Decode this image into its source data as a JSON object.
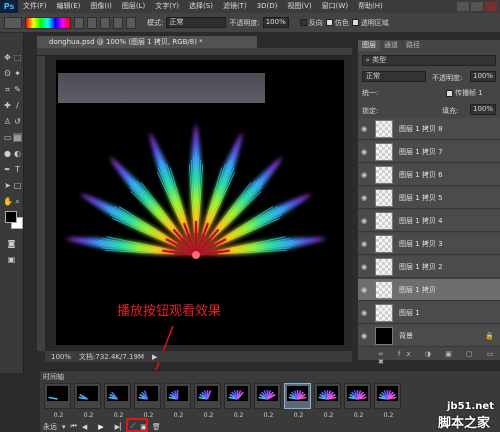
{
  "app": {
    "logo": "Ps"
  },
  "menu": [
    "文件(F)",
    "编辑(E)",
    "图像(I)",
    "图层(L)",
    "文字(Y)",
    "选择(S)",
    "滤镜(T)",
    "3D(D)",
    "视图(V)",
    "窗口(W)",
    "帮助(H)"
  ],
  "options": {
    "mode_label": "模式:",
    "mode_value": "正常",
    "opacity_label": "不透明度:",
    "opacity_value": "100%",
    "reverse": "反向",
    "dither": "仿色",
    "transparency": "透明区域"
  },
  "document": {
    "tab": "donghua.psd @ 100% (图层 1 拷贝, RGB/8) *",
    "zoom": "100%",
    "doc_info": "文档:732.4K/7.19M",
    "annotation": "播放按钮观看效果"
  },
  "panels": {
    "tabs": [
      "图层",
      "通道",
      "路径"
    ],
    "search": "类型",
    "blend_mode": "正常",
    "opacity_label": "不透明度:",
    "opacity_value": "100%",
    "unify_label": "统一:",
    "propagate": "传播帧 1",
    "lock_label": "锁定:",
    "fill_label": "填充:",
    "fill_value": "100%",
    "layers": [
      {
        "name": "图层 1 拷贝 8",
        "selected": false
      },
      {
        "name": "图层 1 拷贝 7",
        "selected": false
      },
      {
        "name": "图层 1 拷贝 6",
        "selected": false
      },
      {
        "name": "图层 1 拷贝 5",
        "selected": false
      },
      {
        "name": "图层 1 拷贝 4",
        "selected": false
      },
      {
        "name": "图层 1 拷贝 3",
        "selected": false
      },
      {
        "name": "图层 1 拷贝 2",
        "selected": false
      },
      {
        "name": "图层 1 拷贝",
        "selected": true
      },
      {
        "name": "图层 1",
        "selected": false
      },
      {
        "name": "背景",
        "selected": false
      }
    ]
  },
  "timeline": {
    "title": "时间轴",
    "loop": "永远",
    "frames": [
      {
        "delay": "0.2"
      },
      {
        "delay": "0.2"
      },
      {
        "delay": "0.2"
      },
      {
        "delay": "0.2"
      },
      {
        "delay": "0.2"
      },
      {
        "delay": "0.2"
      },
      {
        "delay": "0.2"
      },
      {
        "delay": "0.2"
      },
      {
        "delay": "0.2"
      },
      {
        "delay": "0.2"
      },
      {
        "delay": "0.2"
      },
      {
        "delay": "0.2"
      }
    ],
    "selected_frame": 8
  },
  "watermark": {
    "site": "jb51.net",
    "name": "脚本之家"
  },
  "colors": {
    "accent_red": "#e1141a",
    "canvas": "#000000"
  }
}
